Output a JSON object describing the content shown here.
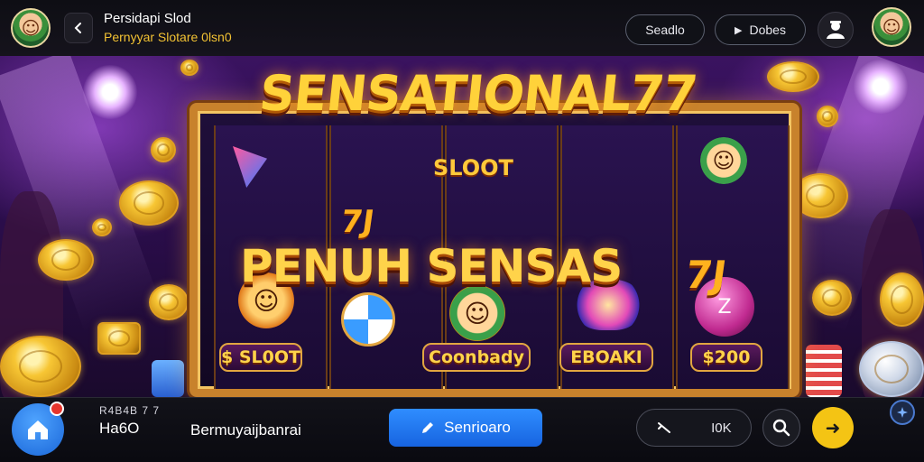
{
  "header": {
    "title": "Persidapi Slod",
    "subtitle": "Pernyyar Slotare 0lsn0",
    "search_label": "Seadlo",
    "dobes_label": "Dobes",
    "back_icon": "chevron-left-icon",
    "user_icon": "user-icon"
  },
  "game": {
    "logo": "SENSATIONAL77",
    "sub_logo": "SLOOT",
    "headline": "PENUH SENSAS",
    "seven_side": "7J",
    "seven_left": "7J",
    "tags": [
      "$ SL0OT",
      "Coonbady",
      "EBOAKI",
      "$200"
    ]
  },
  "bottom": {
    "stat_label": "R4B4B 7 7",
    "stat_value": "Ha6O",
    "game_name": "Bermuyaijbanrai",
    "spin_label": "Senrioaro",
    "ctrl_value": "I0K",
    "home_icon": "home-icon",
    "search_icon": "search-icon",
    "go_icon": "arrow-right-icon"
  },
  "colors": {
    "accent_blue": "#1f7af0",
    "accent_yellow": "#f4c414",
    "gold": "#ffd23a",
    "frame": "#c8822c",
    "subtitle_yellow": "#f2c233"
  }
}
